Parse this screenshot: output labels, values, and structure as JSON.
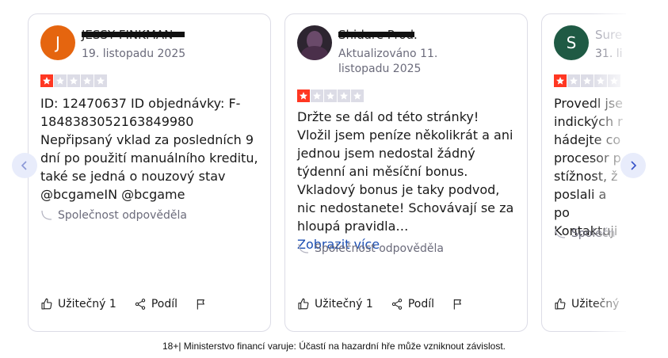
{
  "reviews": [
    {
      "avatar_letter": "J",
      "avatar_color": "#e5650f",
      "name": "JESSY FINKMAN",
      "date": "19. listopadu 2025",
      "rating": 1,
      "text": "ID: 12470637 ID objednávky: F-1848383052163849980 Nepřipsaný vklad za posledních 9 dní po použití manuálního kreditu, také se jedná o nouzový stav @bcgameIN @bcgame",
      "reply_label": "Společnost odpověděla",
      "useful_label": "Užitečný 1",
      "share_label": "Podíl"
    },
    {
      "avatar_letter": "",
      "name": "Shidare Prod.",
      "date": "Aktualizováno 11. listopadu 2025",
      "rating": 1,
      "text": "Držte se dál od této stránky! Vložil jsem peníze několikrát a ani jednou jsem nedostal žádný týdenní ani měsíční bonus. Vkladový bonus je taky podvod, nic nedostanete! Schovávají se za hloupá pravidla…",
      "more_label": "Zobrazit více",
      "reply_label": "Společnost odpověděla",
      "useful_label": "Užitečný 1",
      "share_label": "Podíl"
    },
    {
      "avatar_letter": "S",
      "avatar_color": "#1f5a44",
      "name": "Sure",
      "date": "31. li",
      "rating": 1,
      "text": "Provedl jse indických r hádejte co procesor p stížnost, ž poslali a po Kontaktuji",
      "reply_label": "Společn",
      "useful_label": "Užitečný"
    }
  ],
  "footer": {
    "disclaimer": "18+| Ministerstvo financí varuje: Účastí na hazardní hře může vzniknout závislost."
  },
  "colors": {
    "star_active": "#ff3722",
    "star_inactive": "#dcdce6",
    "link": "#1c4fb3"
  }
}
